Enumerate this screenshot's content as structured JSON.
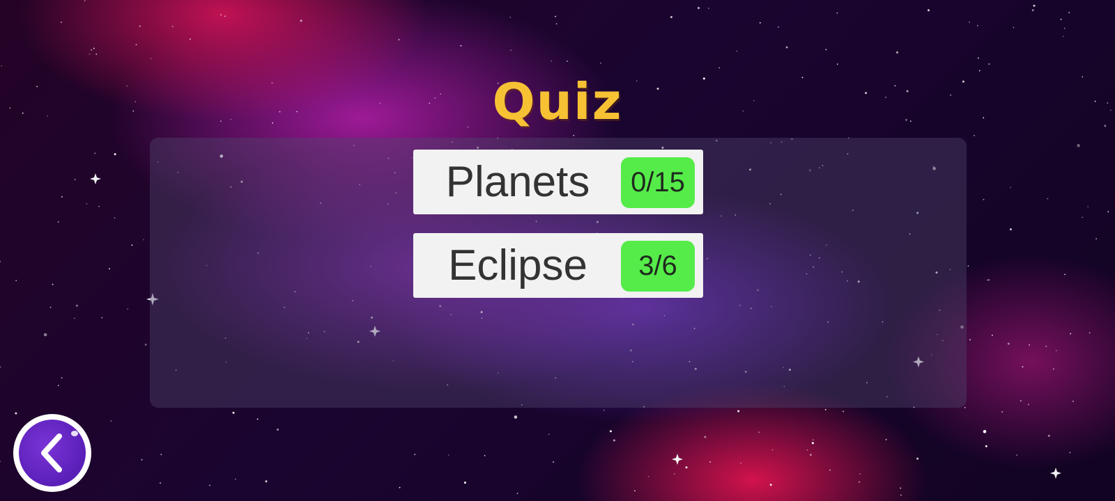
{
  "screen": {
    "title": "Quiz",
    "colors": {
      "title": "#f7c134",
      "score_badge": "#55ec4a",
      "button_bg": "#f2f2f2",
      "back_button": "#5a1fb8"
    }
  },
  "quizzes": [
    {
      "label": "Planets",
      "score": "0/15"
    },
    {
      "label": "Eclipse",
      "score": "3/6"
    }
  ],
  "navigation": {
    "back_icon": "chevron-left-icon"
  }
}
